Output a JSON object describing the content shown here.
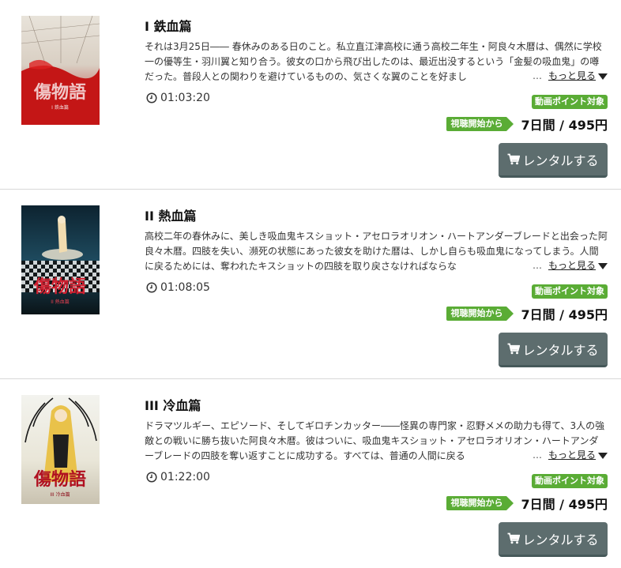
{
  "items": [
    {
      "title": "I 鉄血篇",
      "synopsis": "それは3月25日―― 春休みのある日のこと。私立直江津高校に通う高校二年生・阿良々木暦は、偶然に学校一の優等生・羽川翼と知り合う。彼女の口から飛び出したのは、最近出没するという「金髪の吸血鬼」の噂だった。普段人との関わりを避けているものの、気さくな翼のことを好まし",
      "ellipsis": "…",
      "more_label": "もっと見る",
      "duration": "01:03:20",
      "point_badge": "動画ポイント対象",
      "start_badge": "視聴開始から",
      "price": "7日間 / 495円",
      "rent_label": "レンタルする",
      "poster_title": "傷物語",
      "poster_sub": "I 鉄血篇"
    },
    {
      "title": "II 熱血篇",
      "synopsis": "高校二年の春休みに、美しき吸血鬼キスショット・アセロラオリオン・ハートアンダーブレードと出会った阿良々木暦。四肢を失い、瀕死の状態にあった彼女を助けた暦は、しかし自らも吸血鬼になってしまう。人間に戻るためには、奪われたキスショットの四肢を取り戻さなければならな",
      "ellipsis": "…",
      "more_label": "もっと見る",
      "duration": "01:08:05",
      "point_badge": "動画ポイント対象",
      "start_badge": "視聴開始から",
      "price": "7日間 / 495円",
      "rent_label": "レンタルする",
      "poster_title": "傷物語",
      "poster_sub": "II 熱血篇"
    },
    {
      "title": "III 冷血篇",
      "synopsis": "ドラマツルギー、エピソード、そしてギロチンカッター――怪異の専門家・忍野メメの助力も得て、3人の強敵との戦いに勝ち抜いた阿良々木暦。彼はついに、吸血鬼キスショット・アセロラオリオン・ハートアンダーブレードの四肢を奪い返すことに成功する。すべては、普通の人間に戻る",
      "ellipsis": "…",
      "more_label": "もっと見る",
      "duration": "01:22:00",
      "point_badge": "動画ポイント対象",
      "start_badge": "視聴開始から",
      "price": "7日間 / 495円",
      "rent_label": "レンタルする",
      "poster_title": "傷物語",
      "poster_sub": "III 冷血篇"
    }
  ],
  "icons": {
    "clock": "clock-icon",
    "cart": "cart-icon",
    "caret": "caret-down-icon"
  },
  "colors": {
    "badge_green": "#5aac35",
    "button_gray": "#5d6d6e",
    "text_dark": "#111111"
  }
}
